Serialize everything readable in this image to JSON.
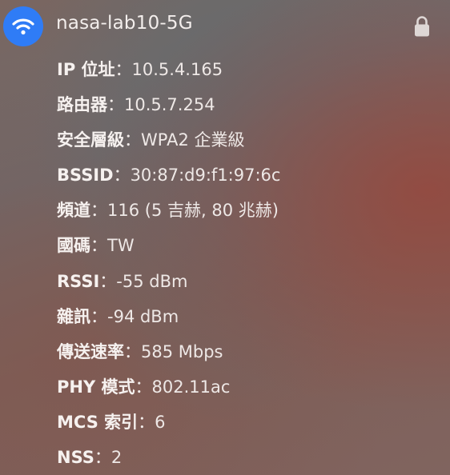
{
  "network": {
    "ssid": "nasa-lab10-5G",
    "icon": "wifi-icon",
    "lock_icon": "lock-icon",
    "accent_color": "#2f7cf6"
  },
  "details": [
    {
      "key": "IP 位址",
      "value": "10.5.4.165"
    },
    {
      "key": "路由器",
      "value": "10.5.7.254"
    },
    {
      "key": "安全層級",
      "value": "WPA2 企業級"
    },
    {
      "key": "BSSID",
      "value": "30:87:d9:f1:97:6c"
    },
    {
      "key": "頻道",
      "value": "116 (5 吉赫, 80 兆赫)"
    },
    {
      "key": "國碼",
      "value": "TW"
    },
    {
      "key": "RSSI",
      "value": "-55 dBm"
    },
    {
      "key": "雜訊",
      "value": "-94 dBm"
    },
    {
      "key": "傳送速率",
      "value": "585 Mbps"
    },
    {
      "key": "PHY 模式",
      "value": "802.11ac"
    },
    {
      "key": "MCS 索引",
      "value": "6"
    },
    {
      "key": "NSS",
      "value": "2"
    }
  ],
  "separator": "："
}
